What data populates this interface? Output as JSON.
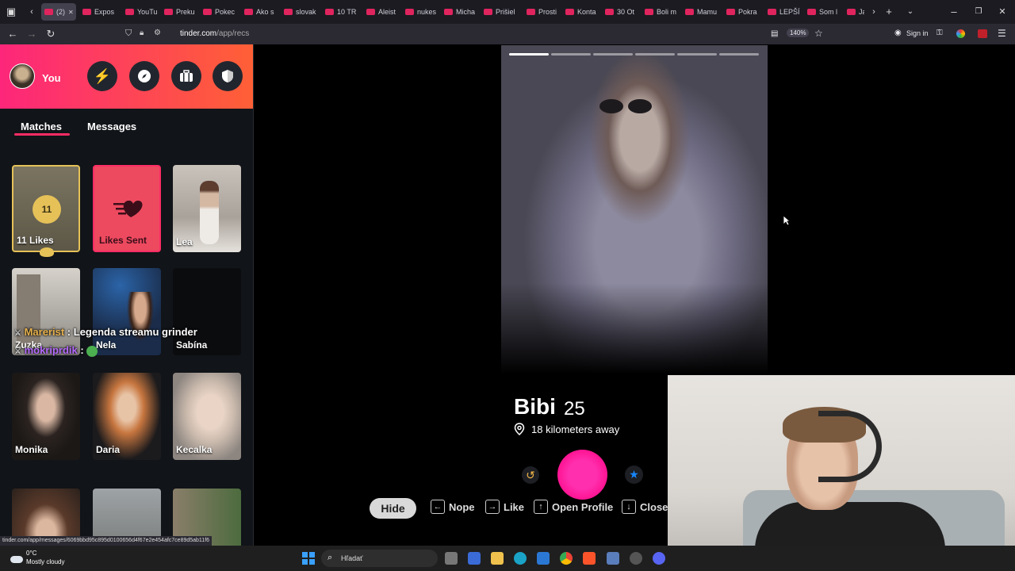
{
  "browser": {
    "tabs": [
      {
        "label": "(2)",
        "active": true
      },
      {
        "label": "Expos"
      },
      {
        "label": "YouTu"
      },
      {
        "label": "Preku"
      },
      {
        "label": "Pokec"
      },
      {
        "label": "Ako s"
      },
      {
        "label": "slovak"
      },
      {
        "label": "10 TR"
      },
      {
        "label": "Aleist"
      },
      {
        "label": "nukes"
      },
      {
        "label": "Micha"
      },
      {
        "label": "Prišiel"
      },
      {
        "label": "Prosti"
      },
      {
        "label": "Konta"
      },
      {
        "label": "30 Ot"
      },
      {
        "label": "Boli m"
      },
      {
        "label": "Mamu"
      },
      {
        "label": "Pokra"
      },
      {
        "label": "LEPŠÍ"
      },
      {
        "label": "Som l"
      },
      {
        "label": "Ja"
      }
    ],
    "url_host": "tinder.com",
    "url_path": "/app/recs",
    "zoom": "140%",
    "sign_in": "Sign in",
    "status_url": "tinder.com/app/messages/6069bbd95c895d0100656d4f67e2e454afc7ce89d5ab11f6"
  },
  "sidebar": {
    "you_label": "You",
    "tabs": [
      "Matches",
      "Messages"
    ],
    "likes_count": "11",
    "likes_label": "11 Likes",
    "likes_sent_label": "Likes Sent",
    "matches": [
      {
        "name": "Lea"
      },
      {
        "name": "Zuzka"
      },
      {
        "name": "Nela"
      },
      {
        "name": "Sabína"
      },
      {
        "name": "Monika"
      },
      {
        "name": "Daria"
      },
      {
        "name": "Kecalka"
      }
    ],
    "chat_overlay": [
      {
        "user": "Marerist",
        "sep": ":",
        "text": "Legenda streamu grinder"
      },
      {
        "user": "mokriprdik",
        "sep": ":",
        "text": ""
      }
    ]
  },
  "profile": {
    "name": "Bibi",
    "age": "25",
    "distance": "18 kilometers away"
  },
  "shortcuts": {
    "hide": "Hide",
    "nope": "Nope",
    "like": "Like",
    "open_profile": "Open Profile",
    "close": "Close"
  },
  "taskbar": {
    "temp": "0°C",
    "weather": "Mostly cloudy",
    "search_placeholder": "Hľadať"
  },
  "colors": {
    "brand_start": "#fd267a",
    "brand_end": "#ff6036",
    "likes_gold": "#e5c158",
    "star_blue": "#1786ff"
  }
}
